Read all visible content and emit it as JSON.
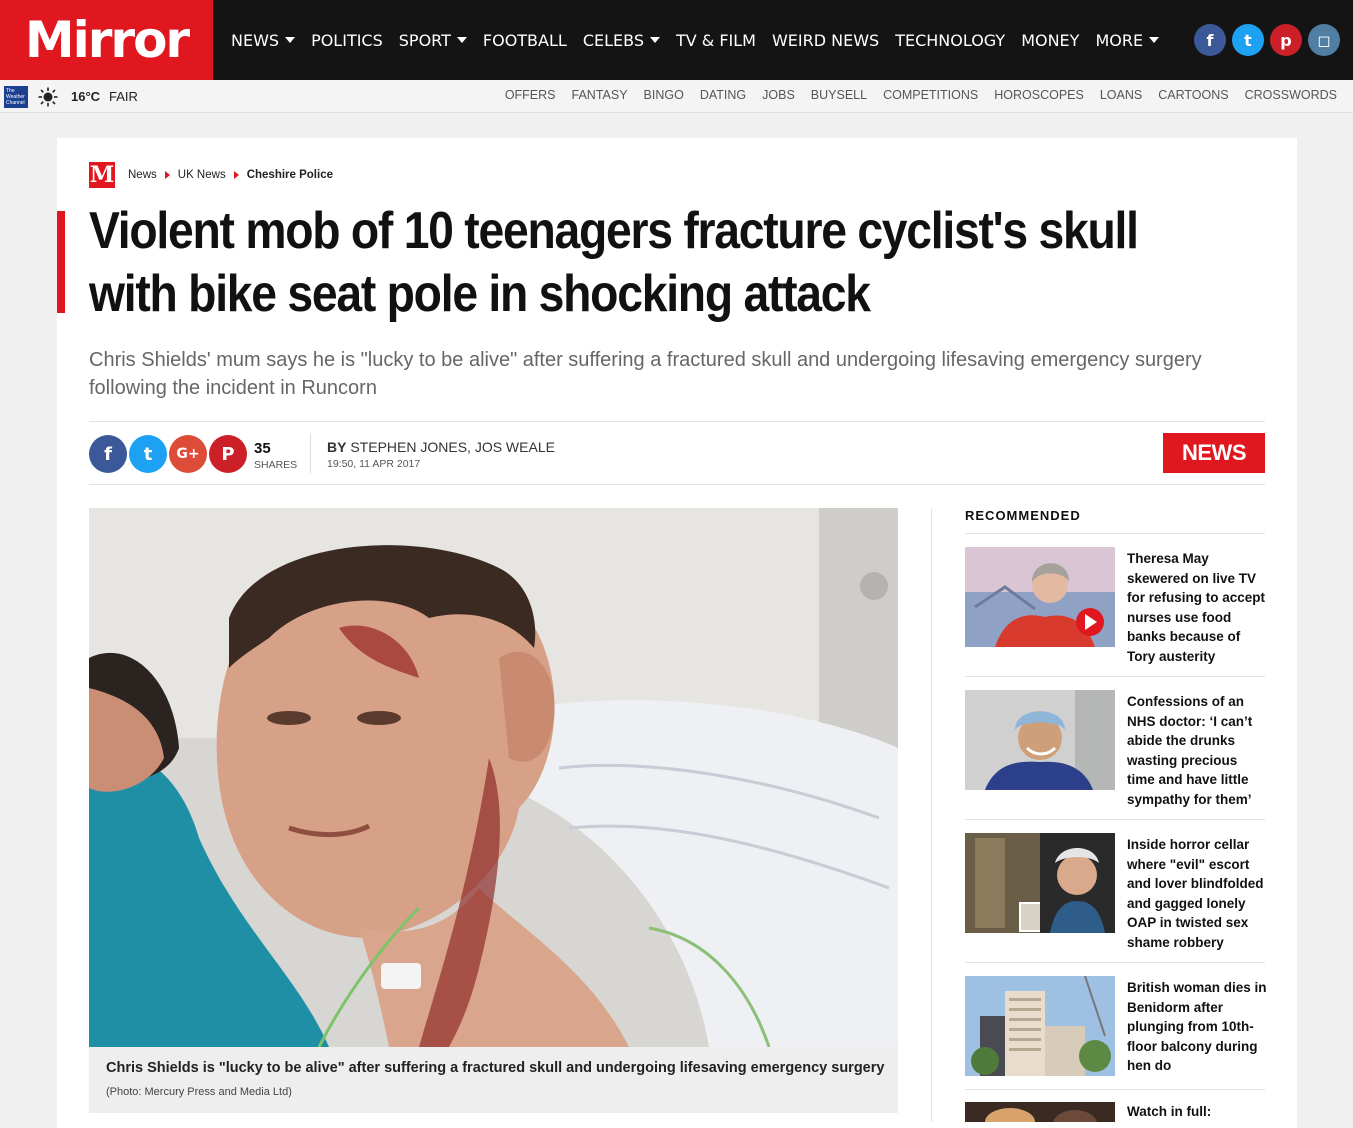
{
  "header": {
    "logo": "Mirror",
    "nav": [
      {
        "label": "NEWS",
        "dropdown": true
      },
      {
        "label": "POLITICS",
        "dropdown": false
      },
      {
        "label": "SPORT",
        "dropdown": true
      },
      {
        "label": "FOOTBALL",
        "dropdown": false
      },
      {
        "label": "CELEBS",
        "dropdown": true
      },
      {
        "label": "TV & FILM",
        "dropdown": false
      },
      {
        "label": "WEIRD NEWS",
        "dropdown": false
      },
      {
        "label": "TECHNOLOGY",
        "dropdown": false
      },
      {
        "label": "MONEY",
        "dropdown": false
      },
      {
        "label": "MORE",
        "dropdown": true
      }
    ],
    "social": [
      {
        "icon": "facebook-icon",
        "glyph": "f",
        "color": "#3b5998"
      },
      {
        "icon": "twitter-icon",
        "glyph": "t",
        "color": "#1da1f2"
      },
      {
        "icon": "pinterest-icon",
        "glyph": "p",
        "color": "#cb2027"
      },
      {
        "icon": "instagram-icon",
        "glyph": "◻",
        "color": "#517fa4"
      }
    ]
  },
  "subbar": {
    "weather_badge": "The Weather Channel",
    "temperature": "16°C",
    "condition": "FAIR",
    "links": [
      "OFFERS",
      "FANTASY",
      "BINGO",
      "DATING",
      "JOBS",
      "BUYSELL",
      "COMPETITIONS",
      "HOROSCOPES",
      "LOANS",
      "CARTOONS",
      "CROSSWORDS"
    ]
  },
  "article": {
    "breadcrumb": [
      "News",
      "UK News",
      "Cheshire Police"
    ],
    "headline": "Violent mob of 10 teenagers fracture cyclist's skull with bike seat pole in shocking attack",
    "standfirst": "Chris Shields' mum says he is \"lucky to be alive\" after suffering a fractured skull and undergoing lifesaving emergency surgery following the incident in Runcorn",
    "share_count": "35",
    "share_label": "SHARES",
    "by_prefix": "BY",
    "authors": "STEPHEN JONES, JOS WEALE",
    "date": "19:50, 11 APR 2017",
    "section_badge": "NEWS",
    "image_caption": "Chris Shields is \"lucky to be alive\" after suffering a fractured skull and undergoing lifesaving emergency surgery",
    "image_credit": "(Photo: Mercury Press and Media Ltd)"
  },
  "sidebar": {
    "title": "RECOMMENDED",
    "items": [
      {
        "text": "Theresa May skewered on live TV for refusing to accept nurses use food banks because of Tory austerity",
        "video": true
      },
      {
        "text": "Confessions of an NHS doctor: ‘I can’t abide the drunks wasting precious time and have little sympathy for them’",
        "video": false
      },
      {
        "text": "Inside horror cellar where \"evil\" escort and lover blindfolded and gagged lonely OAP in twisted sex shame robbery",
        "video": false
      },
      {
        "text": "British woman dies in Benidorm after plunging from 10th-floor balcony during hen do",
        "video": false
      },
      {
        "text": "Watch in full:",
        "video": false
      }
    ]
  },
  "colors": {
    "brand_red": "#e0171f",
    "nav_bg": "#141414"
  }
}
